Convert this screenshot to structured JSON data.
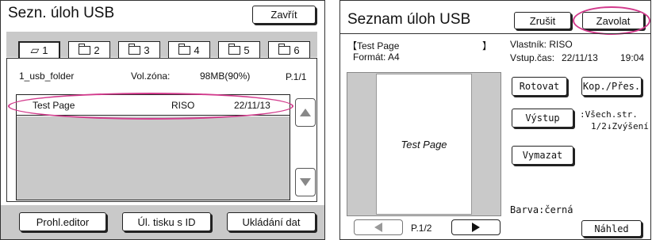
{
  "left": {
    "title": "Sezn. úloh USB",
    "close_label": "Zavřít",
    "tabs": [
      {
        "label": "1",
        "icon": "folder-open-icon"
      },
      {
        "label": "2",
        "icon": "folder-icon"
      },
      {
        "label": "3",
        "icon": "folder-icon"
      },
      {
        "label": "4",
        "icon": "folder-icon"
      },
      {
        "label": "5",
        "icon": "folder-icon"
      },
      {
        "label": "6",
        "icon": "folder-icon"
      }
    ],
    "folder_name": "1_usb_folder",
    "free_zone_label": "Vol.zóna:",
    "free_zone_value": "98MB(90%)",
    "page": "P.1/1",
    "job": {
      "name": "Test Page",
      "owner": "RISO",
      "date": "22/11/13"
    },
    "scroll_up": "up-arrow-icon",
    "scroll_down": "down-arrow-icon",
    "buttons": {
      "editor": "Prohl.editor",
      "id_print": "Úl. tisku s ID",
      "store": "Ukládání dat"
    }
  },
  "right": {
    "title": "Seznam úloh USB",
    "cancel_label": "Zrušit",
    "call_label": "Zavolat",
    "doc_name_line": "【Test Page",
    "doc_name_close": "】",
    "format_label": "Formát: A4",
    "owner_line": "Vlastník: RISO",
    "input_time_label": "Vstup.čas:",
    "input_time_date": "22/11/13",
    "input_time_time": "19:04",
    "preview_text": "Test Page",
    "rotate_label": "Rotovat",
    "copy_move_label": "Kop./Přes.",
    "output_label": "Výstup",
    "output_pages": ":Všech.str.",
    "output_order": "1/2↓Zvýšení",
    "delete_label": "Vymazat",
    "color_line": "Barva:černá",
    "page": "P.1/2",
    "preview_btn": "Náhled",
    "prev_icon": "left-triangle-icon",
    "next_icon": "right-triangle-icon"
  },
  "colors": {
    "highlight": "#d23a8c",
    "gray_area": "#c9c9c9"
  }
}
